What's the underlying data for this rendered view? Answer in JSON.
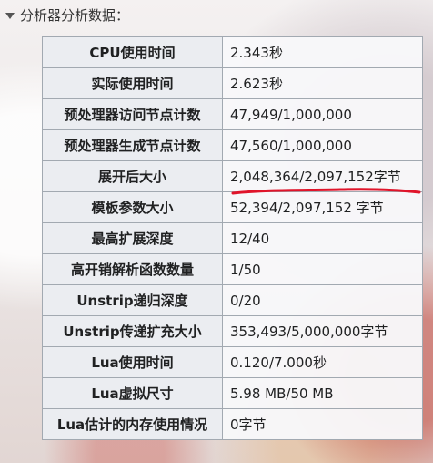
{
  "header": {
    "label": "分析器分析数据："
  },
  "rows": [
    {
      "key": "CPU使用时间",
      "value": "2.343秒"
    },
    {
      "key": "实际使用时间",
      "value": "2.623秒"
    },
    {
      "key": "预处理器访问节点计数",
      "value": "47,949/1,000,000"
    },
    {
      "key": "预处理器生成节点计数",
      "value": "47,560/1,000,000"
    },
    {
      "key": "展开后大小",
      "value": "2,048,364/2,097,152字节"
    },
    {
      "key": "模板参数大小",
      "value": "52,394/2,097,152 字节"
    },
    {
      "key": "最高扩展深度",
      "value": "12/40"
    },
    {
      "key": "高开销解析函数数量",
      "value": "1/50"
    },
    {
      "key": "Unstrip递归深度",
      "value": "0/20"
    },
    {
      "key": "Unstrip传递扩充大小",
      "value": "353,493/5,000,000字节"
    },
    {
      "key": "Lua使用时间",
      "value": "0.120/7.000秒"
    },
    {
      "key": "Lua虚拟尺寸",
      "value": "5.98 MB/50 MB"
    },
    {
      "key": "Lua估计的内存使用情况",
      "value": "0字节"
    }
  ],
  "annotation": {
    "color": "#e0142a",
    "target": "展开后大小"
  },
  "colors": {
    "border": "#a2a9b1",
    "header_cell": "#eaecf0",
    "text": "#202122"
  }
}
